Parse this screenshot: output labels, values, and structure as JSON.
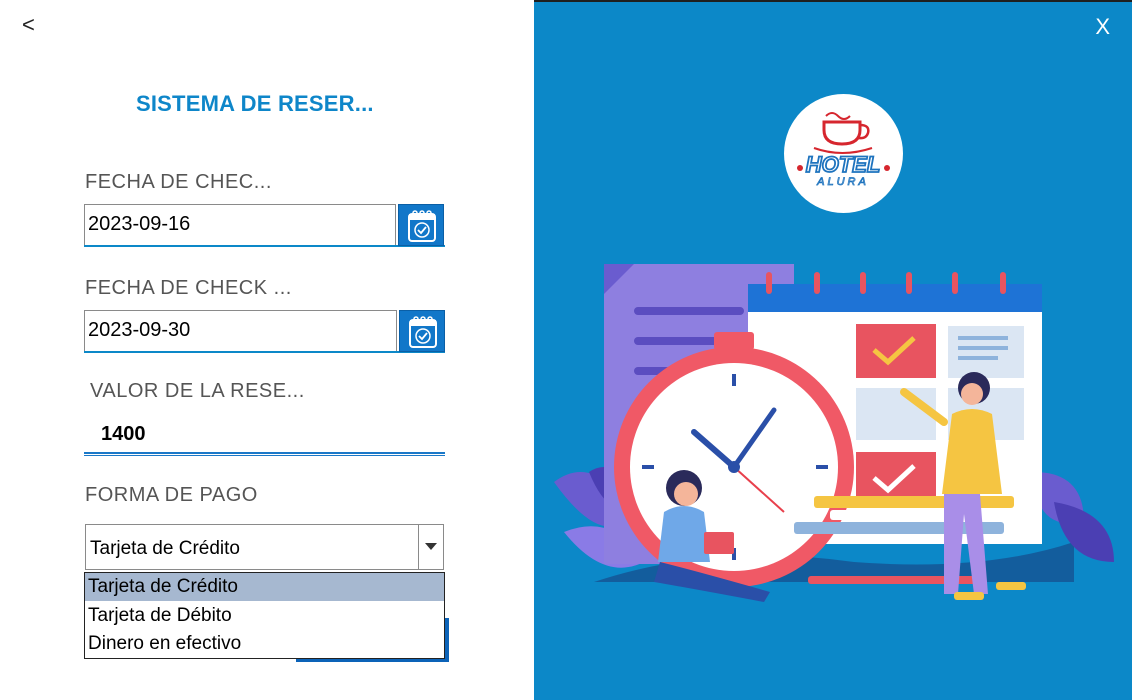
{
  "window": {
    "back_label": "<",
    "close_label": "X"
  },
  "form": {
    "title": "SISTEMA DE RESER...",
    "checkin_label": "FECHA DE CHEC...",
    "checkin_value": "2023-09-16",
    "checkout_label": "FECHA DE CHECK ...",
    "checkout_value": "2023-09-30",
    "value_label": "VALOR DE LA RESE...",
    "value_amount": "1400",
    "payment_label": "FORMA DE PAGO",
    "payment_selected": "Tarjeta de Crédito",
    "payment_options": [
      "Tarjeta de Crédito",
      "Tarjeta de Débito",
      "Dinero en efectivo"
    ]
  },
  "brand": {
    "logo_main": "HOTEL",
    "logo_sub": "ALURA"
  },
  "icons": {
    "back": "chevron-left-icon",
    "close": "close-icon",
    "calendar": "calendar-check-icon",
    "dropdown": "triangle-down-icon",
    "logo": "coffee-cup-icon"
  },
  "colors": {
    "accent": "#0e86c9",
    "panel": "#0c88c8",
    "button": "#1177c9",
    "option_highlight": "#a6b8d0",
    "logo_red": "#d6262e",
    "logo_blue": "#1e73be"
  }
}
